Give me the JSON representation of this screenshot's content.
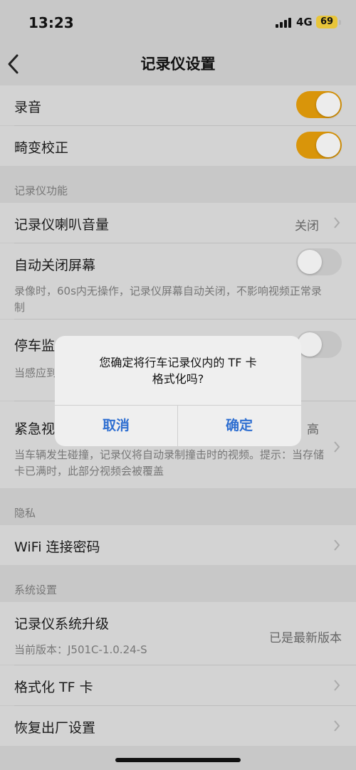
{
  "status_bar": {
    "time": "13:23",
    "network": "4G",
    "battery": "69"
  },
  "nav": {
    "title": "记录仪设置"
  },
  "rows": {
    "recording": {
      "label": "录音",
      "toggle": "on"
    },
    "distortion": {
      "label": "畸变校正",
      "toggle": "on"
    },
    "recorder_section": "记录仪功能",
    "speaker_volume": {
      "label": "记录仪喇叭音量",
      "value": "关闭"
    },
    "auto_screen_off": {
      "label": "自动关闭屏幕",
      "toggle": "off",
      "note": "录像时，60s内无操作，记录仪屏幕自动关闭，不影响视频正常录制"
    },
    "parking_monitor": {
      "label": "停车监",
      "note": "当感应到"
    },
    "emergency_video": {
      "label": "紧急视",
      "value": "高",
      "note": "当车辆发生碰撞，记录仪将自动录制撞击时的视频。提示：当存储卡已满时，此部分视频会被覆盖"
    },
    "privacy_section": "隐私",
    "wifi_password": {
      "label": "WiFi 连接密码"
    },
    "system_section": "系统设置",
    "system_upgrade": {
      "label": "记录仪系统升级",
      "sub": "当前版本：J501C-1.0.24-S",
      "value": "已是最新版本"
    },
    "format_tf": {
      "label": "格式化 TF 卡"
    },
    "factory_reset": {
      "label": "恢复出厂设置"
    }
  },
  "dialog": {
    "message_line1": "您确定将行车记录仪内的 TF 卡",
    "message_line2": "格式化吗?",
    "cancel": "取消",
    "confirm": "确定"
  },
  "colors": {
    "toggle_on": "#d9950a",
    "alert_button": "#2f6fd1"
  }
}
